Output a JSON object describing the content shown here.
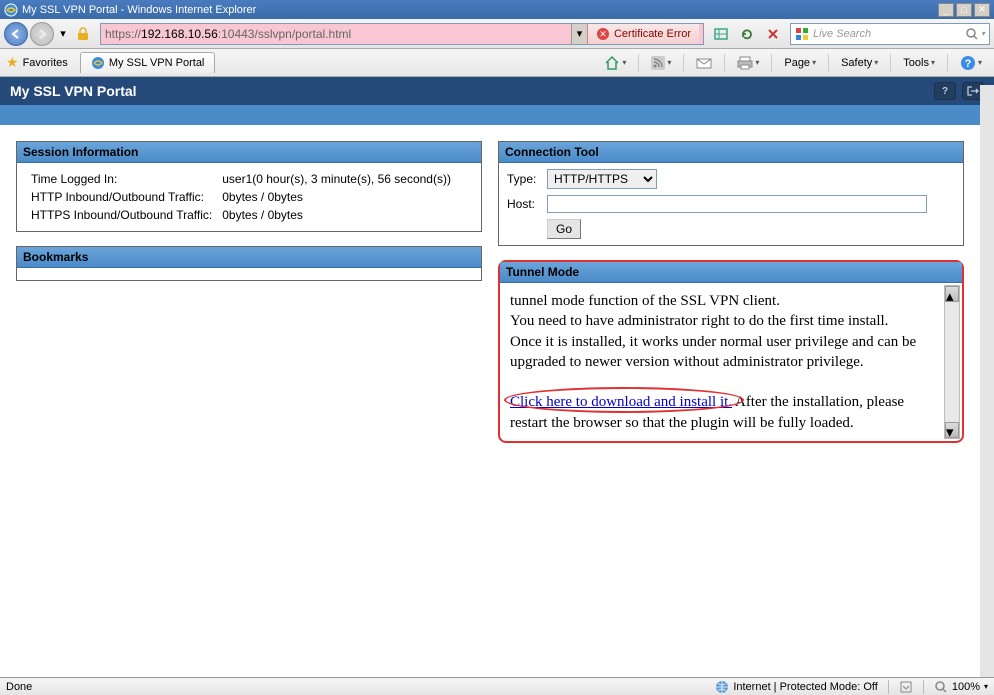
{
  "window": {
    "title": "My SSL VPN Portal - Windows Internet Explorer"
  },
  "address": {
    "scheme": "https://",
    "host": "192.168.10.56",
    "path": ":10443/sslvpn/portal.html",
    "cert_error": "Certificate Error"
  },
  "search": {
    "placeholder": "Live Search"
  },
  "favbar": {
    "label": "Favorites",
    "tab_title": "My SSL VPN Portal"
  },
  "menus": {
    "page": "Page",
    "safety": "Safety",
    "tools": "Tools"
  },
  "portal": {
    "title": "My SSL VPN Portal"
  },
  "session": {
    "header": "Session Information",
    "rows": [
      {
        "label": "Time Logged In:",
        "value": "user1(0 hour(s), 3 minute(s), 56 second(s))"
      },
      {
        "label": "HTTP Inbound/Outbound Traffic:",
        "value": "0bytes / 0bytes"
      },
      {
        "label": "HTTPS Inbound/Outbound Traffic:",
        "value": "0bytes / 0bytes"
      }
    ]
  },
  "bookmarks": {
    "header": "Bookmarks"
  },
  "connection": {
    "header": "Connection Tool",
    "type_label": "Type:",
    "type_value": "HTTP/HTTPS",
    "host_label": "Host:",
    "host_value": "",
    "go": "Go"
  },
  "tunnel": {
    "header": "Tunnel Mode",
    "line1": "tunnel mode function of the SSL VPN client.",
    "line2": "You need to have administrator right to do the first time install.",
    "line3": "Once it is installed, it works under normal user privilege and can be upgraded to newer version without administrator privilege.",
    "link_text": "Click here to download and install it.",
    "after_link": "After the installation, please restart the browser so that the plugin will be fully loaded."
  },
  "status": {
    "left": "Done",
    "zone": "Internet | Protected Mode: Off",
    "zoom": "100%"
  }
}
